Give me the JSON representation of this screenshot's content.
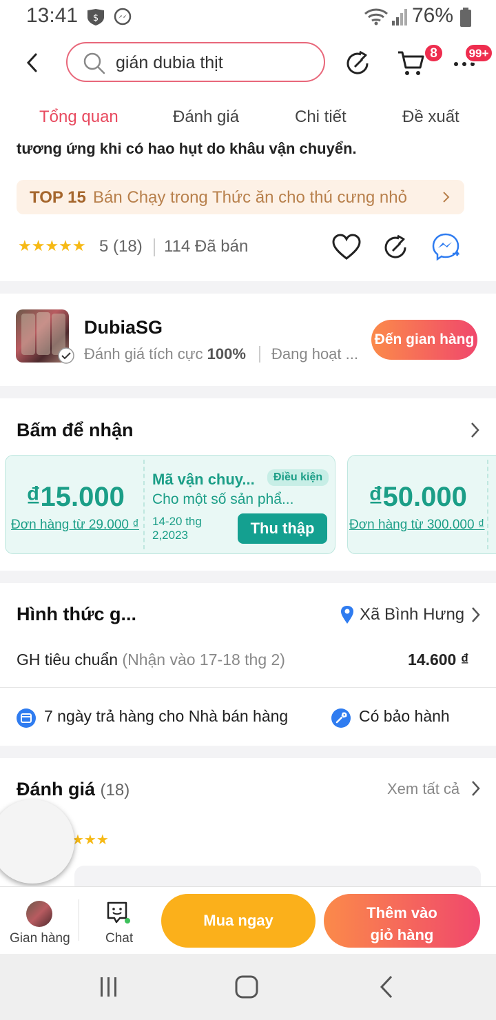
{
  "status_bar": {
    "time": "13:41",
    "battery": "76%"
  },
  "header": {
    "search_query": "gián dubia thịt",
    "cart_count": "8",
    "more_count": "99+"
  },
  "tabs": [
    {
      "label": "Tổng quan",
      "active": true
    },
    {
      "label": "Đánh giá",
      "active": false
    },
    {
      "label": "Chi tiết",
      "active": false
    },
    {
      "label": "Đề xuất",
      "active": false
    }
  ],
  "overview": {
    "description_tail": "tương ứng khi  có hao hụt do khâu vận chuyển.",
    "top_badge": {
      "rank": "TOP 15",
      "category": "Bán Chạy trong Thức ăn cho thú cưng nhỏ"
    },
    "rating": {
      "stars": "★★★★★",
      "score": "5",
      "count": "(18)"
    },
    "sold": "114 Đã bán"
  },
  "shop": {
    "name": "DubiaSG",
    "rating_label": "Đánh giá tích cực",
    "rating_value": "100%",
    "status": "Đang hoạt ...",
    "button": "Đến gian hàng"
  },
  "vouchers": {
    "title": "Bấm để nhận",
    "items": [
      {
        "amount": "₫15.000",
        "min_order": "Đơn hàng từ 29.000 ₫"
      },
      {
        "title": "Mã vận chuy...",
        "tag": "Điều kiện",
        "subtitle": "Cho một số sản phẩ...",
        "date_line1": "14-20 thg",
        "date_line2": "2,2023",
        "button": "Thu thập"
      },
      {
        "amount": "₫50.000",
        "min_order": "Đơn hàng từ 300.000 ₫"
      }
    ]
  },
  "shipping": {
    "title": "Hình thức g...",
    "location": "Xã Bình Hưng",
    "method": "GH tiêu chuẩn",
    "eta": "(Nhận vào 17-18 thg 2)",
    "fee": "14.600 ₫",
    "features": [
      "7 ngày trả hàng cho Nhà bán hàng",
      "Có bảo hành"
    ]
  },
  "reviews": {
    "title": "Đánh giá",
    "count": "(18)",
    "see_all": "Xem tất cả",
    "stars_partial": "★★★"
  },
  "bottom_bar": {
    "shop": "Gian hàng",
    "chat": "Chat",
    "buy_now": "Mua ngay",
    "add_to_cart_line1": "Thêm vào",
    "add_to_cart_line2": "giỏ hàng"
  },
  "colors": {
    "accent": "#e84a5f",
    "teal": "#1b9e87",
    "orange": "#fbb01b"
  }
}
